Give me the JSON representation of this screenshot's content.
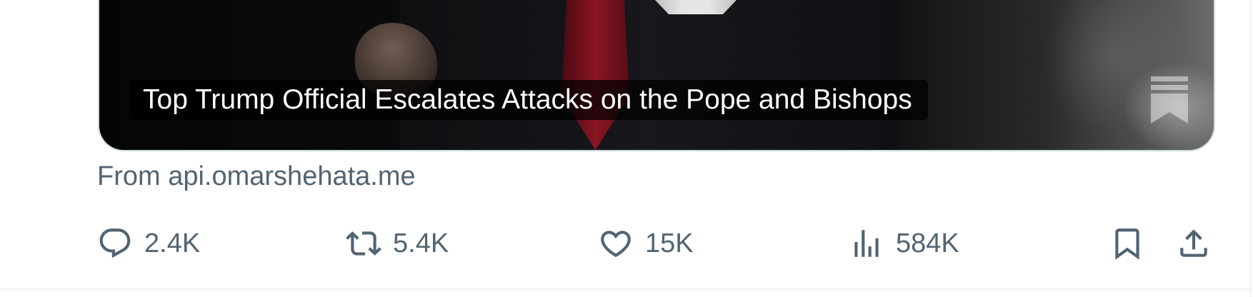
{
  "card": {
    "headline": "Top Trump Official Escalates Attacks on the Pope and Bishops",
    "source_text": "From api.omarshehata.me"
  },
  "actions": {
    "replies": "2.4K",
    "reposts": "5.4K",
    "likes": "15K",
    "views": "584K",
    "bookmark_icon": "bookmark-icon",
    "share_icon": "share-icon"
  },
  "colors": {
    "secondary_text": "#536471",
    "divider": "#eff3f4",
    "card_border": "#cfd9de"
  }
}
